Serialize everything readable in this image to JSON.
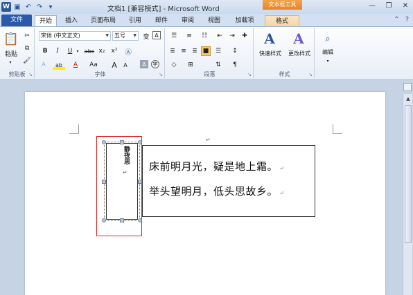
{
  "titlebar": {
    "title": "文档1 [兼容模式] - Microsoft Word",
    "context_group": "文本框工具"
  },
  "tabs": {
    "file": "文件",
    "home": "开始",
    "insert": "插入",
    "page_layout": "页面布局",
    "references": "引用",
    "mailings": "邮件",
    "review": "审阅",
    "view": "视图",
    "addins": "加载项",
    "format": "格式"
  },
  "ribbon": {
    "clipboard": {
      "paste": "粘贴",
      "label": "剪贴板"
    },
    "font": {
      "name": "宋体 (中文正文)",
      "size": "五号",
      "label": "字体",
      "bold": "B",
      "italic": "I",
      "underline": "U",
      "strike": "abc",
      "sub": "x₂",
      "sup": "x²",
      "case": "Aa",
      "grow": "A",
      "shrink": "A",
      "highlight": "ab",
      "color": "A"
    },
    "paragraph": {
      "label": "段落"
    },
    "styles": {
      "quick": "快速样式",
      "change": "更改样式",
      "label": "样式"
    },
    "editing": {
      "label": "编辑"
    }
  },
  "document": {
    "vertical_title": "静夜思",
    "line1": "床前明月光，疑是地上霜。",
    "line2": "举头望明月，低头思故乡。",
    "return_mark": "↵"
  }
}
